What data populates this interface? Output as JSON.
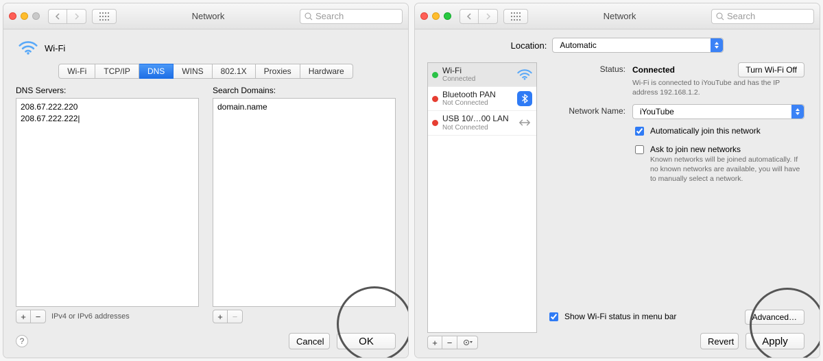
{
  "left": {
    "title": "Network",
    "search_placeholder": "Search",
    "wifi_label": "Wi-Fi",
    "tabs": [
      "Wi-Fi",
      "TCP/IP",
      "DNS",
      "WINS",
      "802.1X",
      "Proxies",
      "Hardware"
    ],
    "active_tab": "DNS",
    "dns_label": "DNS Servers:",
    "dns_servers": [
      "208.67.222.220",
      "208.67.222.222"
    ],
    "domains_label": "Search Domains:",
    "search_domains": [
      "domain.name"
    ],
    "hint": "IPv4 or IPv6 addresses",
    "cancel": "Cancel",
    "ok": "OK"
  },
  "right": {
    "title": "Network",
    "search_placeholder": "Search",
    "location_label": "Location:",
    "location_value": "Automatic",
    "services": [
      {
        "name": "Wi-Fi",
        "sub": "Connected",
        "status": "green",
        "icon": "wifi"
      },
      {
        "name": "Bluetooth PAN",
        "sub": "Not Connected",
        "status": "red",
        "icon": "bluetooth"
      },
      {
        "name": "USB 10/…00 LAN",
        "sub": "Not Connected",
        "status": "red",
        "icon": "usb"
      }
    ],
    "status_label": "Status:",
    "status_value": "Connected",
    "turn_off": "Turn Wi-Fi Off",
    "status_desc": "Wi-Fi is connected to iYouTube and has the IP address 192.168.1.2.",
    "network_name_label": "Network Name:",
    "network_name_value": "iYouTube",
    "auto_join": "Automatically join this network",
    "ask_join": "Ask to join new networks",
    "ask_desc": "Known networks will be joined automatically. If no known networks are available, you will have to manually select a network.",
    "show_menubar": "Show Wi-Fi status in menu bar",
    "advanced": "Advanced…",
    "revert": "Revert",
    "apply": "Apply"
  }
}
